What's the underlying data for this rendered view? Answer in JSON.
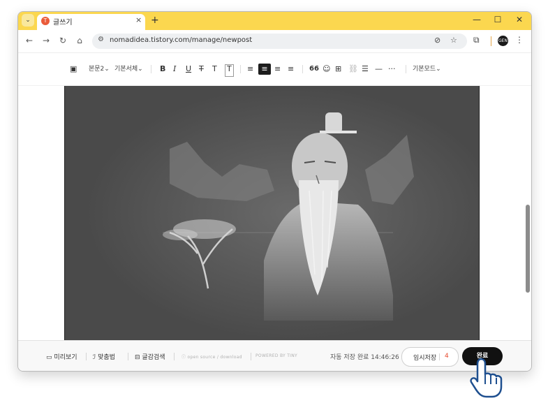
{
  "browser": {
    "tab_dropdown_icon": "⌄",
    "tab_title": "글쓰기",
    "favicon_letter": "T",
    "tab_close": "×",
    "new_tab": "+",
    "window_controls": {
      "minimize": "—",
      "maximize": "☐",
      "close": "✕"
    },
    "nav": {
      "back": "←",
      "forward": "→",
      "reload": "↻",
      "home": "⌂"
    },
    "url": "nomadidea.tistory.com/manage/newpost",
    "site_info_icon": "⚙",
    "eye_off_icon": "⊘",
    "bookmark_icon": "☆",
    "extensions_icon": "⧉",
    "avatar_text": "GEN",
    "menu_icon": "⋮"
  },
  "editor_toolbar": {
    "image_icon": "▣",
    "paragraph_style": "본문2",
    "font_family": "기본서체",
    "bold": "B",
    "italic": "I",
    "underline": "U",
    "strike": "T",
    "text_color": "T",
    "text_bg": "T",
    "align_left": "≡",
    "align_center": "≡",
    "align_right": "≡",
    "align_justify": "≡",
    "quote": "66",
    "emoji": "☺",
    "table": "⊞",
    "link": "⛓",
    "list": "☰",
    "divider": "—",
    "more": "···",
    "mode": "기본모드"
  },
  "bottom": {
    "preview": "미리보기",
    "spellcheck": "맞춤법",
    "find": "글감검색",
    "open_source": "open source / download",
    "powered_by": "POWERED BY TINY",
    "autosave_text": "자동 저장 완료 14:46:26",
    "draft_label": "임시저장",
    "draft_count": "4",
    "done_label": "완료"
  },
  "colors": {
    "titlebar": "#fbd74f",
    "image_bg": "#4a4a4a",
    "done_button": "#111111",
    "draft_count": "#e6492d"
  }
}
